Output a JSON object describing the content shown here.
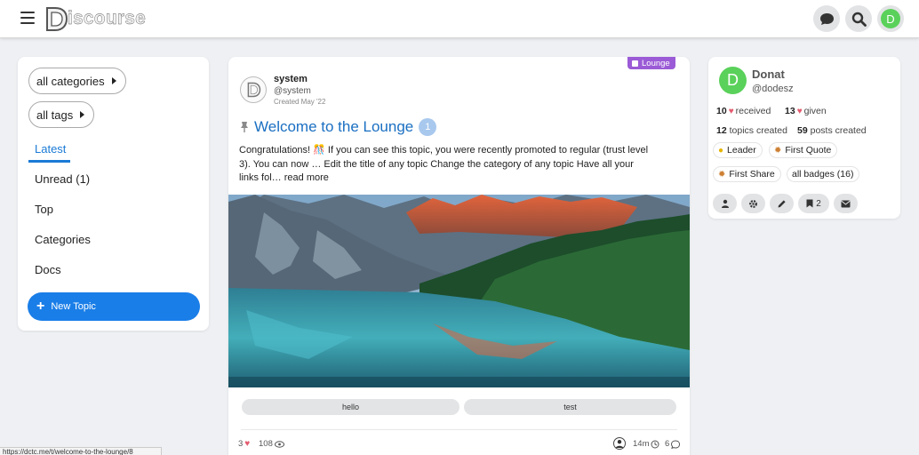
{
  "header": {
    "logo_text": "iscourse",
    "menu_icon": "hamburger-icon",
    "chat_icon": "chat-bubble-icon",
    "search_icon": "search-icon",
    "user_initial": "D",
    "user_color": "#5ad15a"
  },
  "sidebar": {
    "categories_dropdown": "all categories",
    "tags_dropdown": "all tags",
    "nav": [
      {
        "label": "Latest",
        "active": true
      },
      {
        "label": "Unread (1)"
      },
      {
        "label": "Top"
      },
      {
        "label": "Categories"
      },
      {
        "label": "Docs"
      }
    ],
    "new_topic_label": "New Topic",
    "accent": "#1a7ee8"
  },
  "topic": {
    "category": "Lounge",
    "category_color": "#9b5bd6",
    "author_name": "system",
    "author_handle": "@system",
    "created": "Created May '22",
    "title": "Welcome to the Lounge",
    "unread_count": "1",
    "excerpt": "Congratulations! 🎊 If you can see this topic, you were recently promoted to regular (trust level 3). You can now … Edit the title of any topic Change the category of any topic Have all your links fol… ",
    "read_more": "read more",
    "tags": [
      "hello",
      "test"
    ],
    "likes": "3",
    "views": "108",
    "last_activity": "14m",
    "replies": "6"
  },
  "user_card": {
    "name": "Donat",
    "handle": "@dodesz",
    "initial": "D",
    "likes_received": "10",
    "received_label": "received",
    "likes_given": "13",
    "given_label": "given",
    "topics_created": "12",
    "topics_label": "topics created",
    "posts_created": "59",
    "posts_label": "posts created",
    "badges": [
      {
        "label": "Leader",
        "icon": "person-badge-icon"
      },
      {
        "label": "First Quote",
        "icon": "bronze-badge-icon"
      },
      {
        "label": "First Share",
        "icon": "bronze-badge-icon"
      },
      {
        "label": "all badges (16)"
      }
    ],
    "bookmark_count": "2"
  },
  "status_bar": {
    "url": "https://dctc.me/t/welcome-to-the-lounge/8"
  }
}
